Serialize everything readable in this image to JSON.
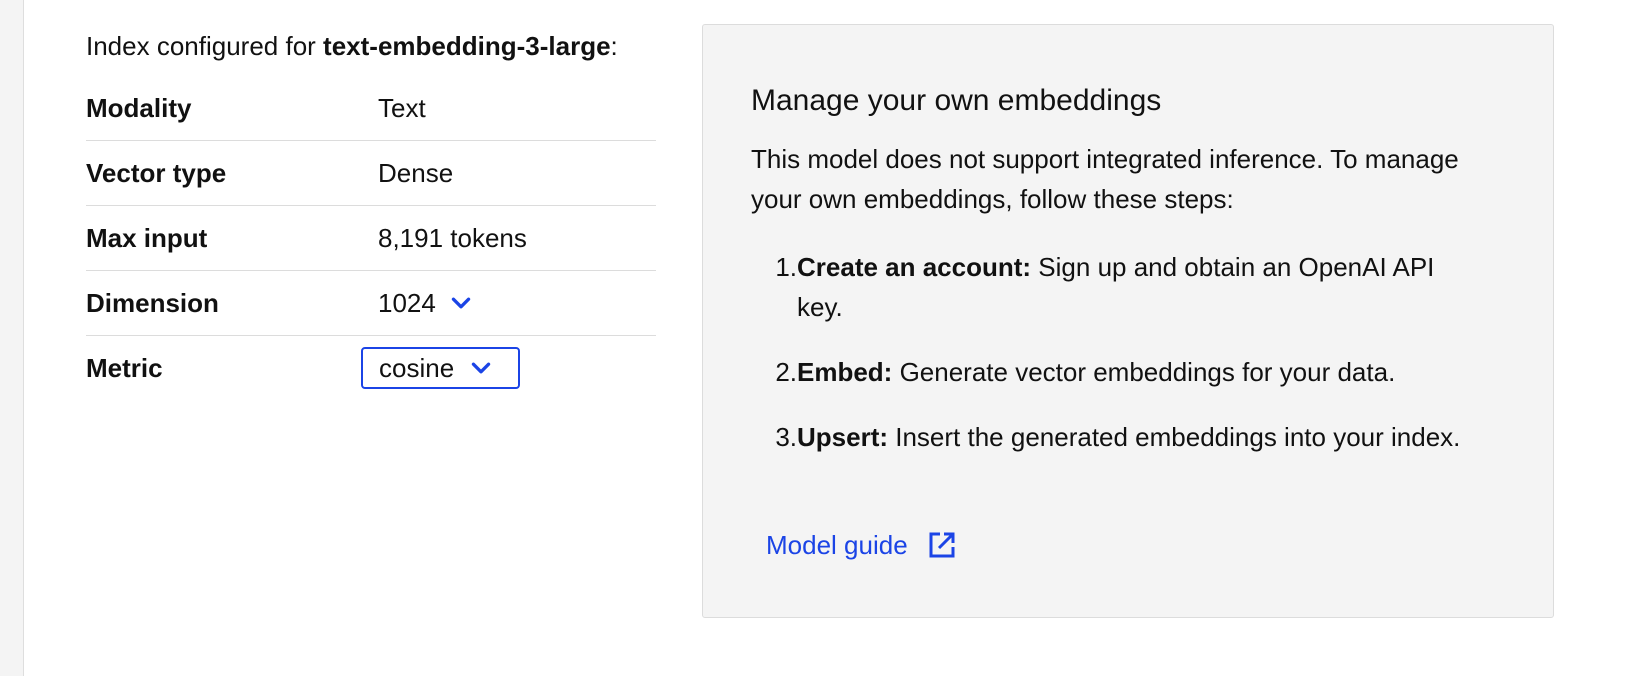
{
  "config": {
    "intro_prefix": "Index configured for ",
    "model_name": "text-embedding-3-large",
    "intro_suffix": ":",
    "rows": [
      {
        "label": "Modality",
        "value": "Text"
      },
      {
        "label": "Vector type",
        "value": "Dense"
      },
      {
        "label": "Max input",
        "value": "8,191 tokens"
      },
      {
        "label": "Dimension",
        "value": "1024"
      },
      {
        "label": "Metric",
        "value": "cosine"
      }
    ],
    "dimension_icon": "chevron-down-icon",
    "metric_icon": "chevron-down-icon"
  },
  "panel": {
    "title": "Manage your own embeddings",
    "description": "This model does not support integrated inference. To manage your own embeddings, follow these steps:",
    "steps": [
      {
        "number": "1.",
        "title": "Create an account:",
        "text": " Sign up and obtain an OpenAI API key."
      },
      {
        "number": "2.",
        "title": "Embed:",
        "text": " Generate vector embeddings for your data."
      },
      {
        "number": "3.",
        "title": "Upsert:",
        "text": " Insert the generated embeddings into your index."
      }
    ],
    "link_label": "Model guide",
    "link_icon": "external-link-icon"
  },
  "colors": {
    "accent": "#1b44e6",
    "panel_bg": "#f4f4f4",
    "divider": "#dcdcdc",
    "text": "#111111"
  }
}
